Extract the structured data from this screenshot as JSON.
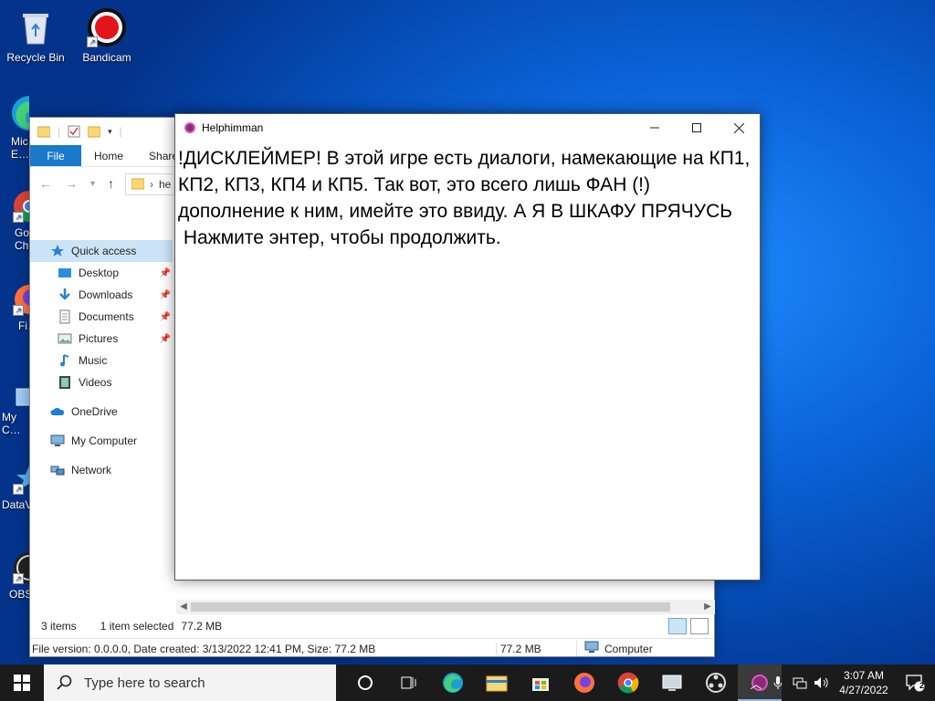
{
  "desktop": {
    "icons": [
      {
        "label": "Recycle Bin",
        "icon": "recycle-bin-icon"
      },
      {
        "label": "Bandicam",
        "icon": "bandicam-icon"
      },
      {
        "label": "Mic… E…",
        "icon": "edge-icon"
      },
      {
        "label": "Go… Ch…",
        "icon": "chrome-icon"
      },
      {
        "label": "Fi…",
        "icon": "firefox-icon"
      },
      {
        "label": "My C…",
        "icon": "computer-icon"
      },
      {
        "label": "DataV…",
        "icon": "datav-icon"
      },
      {
        "label": "OBS…",
        "icon": "obs-icon"
      }
    ]
  },
  "explorer": {
    "tabs": {
      "file": "File",
      "home": "Home",
      "share": "Share"
    },
    "address_text": "he",
    "nav": {
      "quick_access": "Quick access",
      "desktop": "Desktop",
      "downloads": "Downloads",
      "documents": "Documents",
      "pictures": "Pictures",
      "music": "Music",
      "videos": "Videos",
      "onedrive": "OneDrive",
      "my_computer": "My Computer",
      "network": "Network"
    },
    "status": {
      "items": "3 items",
      "selected": "1 item selected",
      "size": "77.2 MB"
    },
    "info": {
      "details": "File version: 0.0.0.0, Date created: 3/13/2022 12:41 PM, Size: 77.2 MB",
      "size": "77.2 MB",
      "location": "Computer"
    }
  },
  "game_window": {
    "title": "Helphimman",
    "line1": "!ДИСКЛЕЙМЕР! В этой игре есть диалоги, намекающие на КП1, КП2, КП3, КП4 и КП5. Так вот, это всего лишь ФАН (!) дополнение к ним, имейте это ввиду. А Я В ШКАФУ ПРЯЧУСЬ",
    "line2": " Нажмите энтер, чтобы продолжить."
  },
  "taskbar": {
    "search_placeholder": "Type here to search",
    "time": "3:07 AM",
    "date": "4/27/2022",
    "notification_count": "2"
  },
  "colors": {
    "accent": "#1979ca",
    "taskbar": "#1b1b1b",
    "selection": "#cce4f7"
  }
}
